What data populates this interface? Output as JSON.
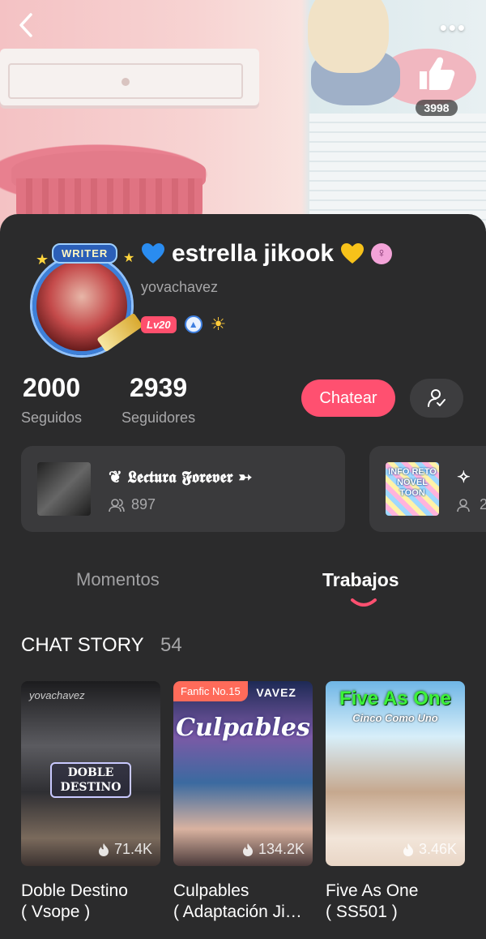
{
  "header": {
    "back_icon": "chevron-left-icon",
    "more_icon": "more-dots-icon",
    "more_label": "•••",
    "likes": {
      "icon": "thumbs-up-icon",
      "count": "3998"
    }
  },
  "profile": {
    "name": "estrella jikook",
    "username": "yovachavez",
    "avatar_badge": "WRITER",
    "level": "Lv20",
    "gender_icon": "female-icon",
    "gender_symbol": "♀",
    "heart_left_color": "#2a8cf0",
    "heart_right_color": "#f7c21a"
  },
  "stats": {
    "following": {
      "value": "2000",
      "label": "Seguidos"
    },
    "followers": {
      "value": "2939",
      "label": "Seguidores"
    }
  },
  "actions": {
    "chat_label": "Chatear",
    "accent": "#ff5070"
  },
  "groups": [
    {
      "name": "❦ 𝕷𝖊𝖈𝖙𝖚𝖗𝖆 𝕱𝖔𝖗𝖊𝖛𝖊𝖗 ➳",
      "members": "897"
    },
    {
      "name": "✧",
      "members": "2",
      "thumb_text": "INFO RETO NOVEL TOON"
    }
  ],
  "tabs": [
    {
      "label": "Momentos",
      "active": false
    },
    {
      "label": "Trabajos",
      "active": true
    }
  ],
  "section": {
    "title": "CHAT STORY",
    "count": "54"
  },
  "books": [
    {
      "title_line1": "Doble Destino",
      "title_line2": "( Vsope )",
      "views": "71.4K",
      "cover_title": "DOBLE DESTINO",
      "cover_author": "yovachavez"
    },
    {
      "title_line1": "Culpables",
      "title_line2": "( Adaptación Ji…",
      "views": "134.2K",
      "rank": "Fanfic No.15",
      "cover_title": "Culpables",
      "cover_top": "VAVEZ"
    },
    {
      "title_line1": "Five As One",
      "title_line2": "( SS501 )",
      "views": "3.46K",
      "cover_title": "Five As One",
      "cover_sub": "Cinco Como Uno"
    }
  ]
}
